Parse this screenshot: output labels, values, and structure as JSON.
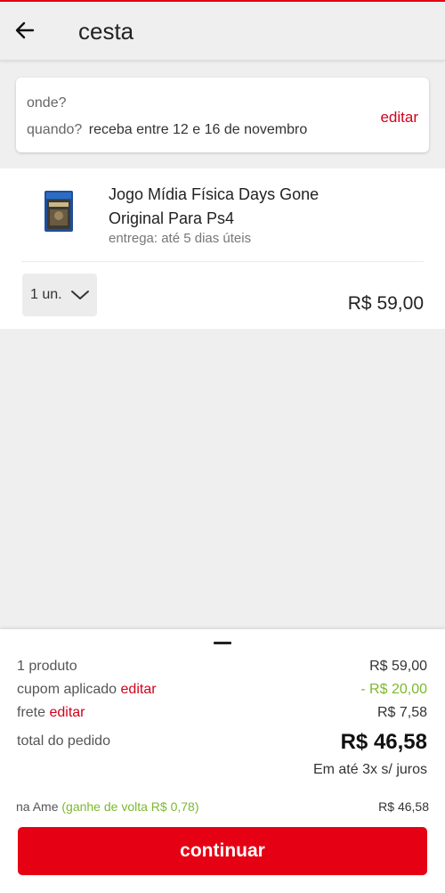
{
  "colors": {
    "accent": "#e60014",
    "link": "#d0021b",
    "discount": "#7cb82f"
  },
  "header": {
    "back_icon": "arrow-left-icon",
    "title": "cesta"
  },
  "delivery": {
    "where_label": "onde?",
    "when_label": "quando?",
    "when_value": "receba entre 12 e 16 de novembro",
    "edit_label": "editar"
  },
  "cart_item": {
    "name": "Jogo Mídia Física Days Gone Original Para Ps4",
    "delivery_time": "entrega: até 5 dias úteis",
    "quantity": "1 un.",
    "price": "R$ 59,00"
  },
  "summary": {
    "products_label": "1 produto",
    "products_value": "R$ 59,00",
    "coupon_label": "cupom aplicado",
    "coupon_edit": "editar",
    "coupon_value": "- R$ 20,00",
    "shipping_label": "frete",
    "shipping_edit": "editar",
    "shipping_value": "R$ 7,58",
    "total_label": "total do pedido",
    "total_value": "R$ 46,58",
    "installments": "Em até 3x s/ juros",
    "ame_label": "na Ame",
    "ame_cashback": "(ganhe de volta R$ 0,78)",
    "ame_value": "R$ 46,58",
    "continue_label": "continuar"
  }
}
